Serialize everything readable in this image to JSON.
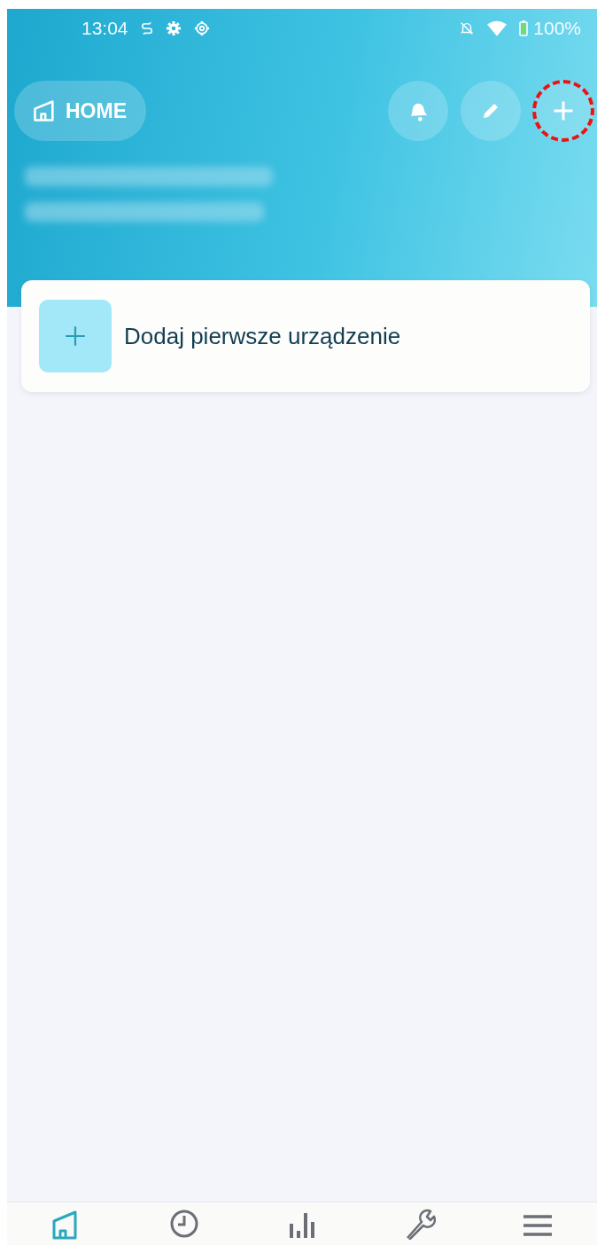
{
  "status_bar": {
    "time": "13:04",
    "battery": "100%"
  },
  "header": {
    "home_button": {
      "label": "HOME"
    },
    "actions": [
      {
        "kind": "bell",
        "highlighted": false
      },
      {
        "kind": "pencil",
        "highlighted": false
      },
      {
        "kind": "plus",
        "highlighted": true
      }
    ]
  },
  "add_device_card": {
    "label": "Dodaj pierwsze urządzenie"
  },
  "bottom_nav": [
    {
      "kind": "home",
      "selected": true
    },
    {
      "kind": "clock",
      "selected": false
    },
    {
      "kind": "chart",
      "selected": false
    },
    {
      "kind": "wrench",
      "selected": false
    },
    {
      "kind": "menu",
      "selected": false
    }
  ]
}
